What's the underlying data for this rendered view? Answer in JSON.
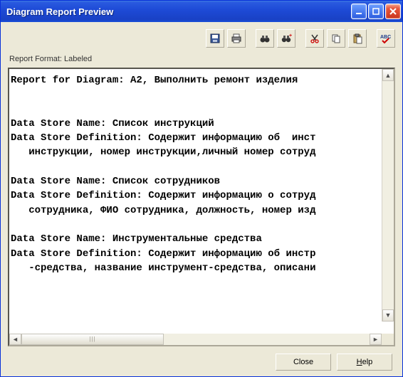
{
  "window": {
    "title": "Diagram Report Preview"
  },
  "toolbar": {
    "save": "Save",
    "print": "Print",
    "find": "Find",
    "findnext": "Find Next",
    "cut": "Cut",
    "copy": "Copy",
    "paste": "Paste",
    "spell": "Spell Check"
  },
  "format_label": "Report Format: Labeled",
  "report": {
    "lines": [
      "Report for Diagram: A2, Выполнить ремонт изделия",
      "",
      "",
      "Data Store Name: Список инструкций",
      "Data Store Definition: Содержит информацию об  инст",
      "   инструкции, номер инструкции,личный номер сотруд",
      "",
      "Data Store Name: Список сотрудников",
      "Data Store Definition: Содержит информацию о сотруд",
      "   сотрудника, ФИО сотрудника, должность, номер изд",
      "",
      "Data Store Name: Инструментальные средства",
      "Data Store Definition: Содержит информацию об инстр",
      "   -средства, название инструмент-средства, описани"
    ]
  },
  "buttons": {
    "close": "Close",
    "help": "Help"
  }
}
